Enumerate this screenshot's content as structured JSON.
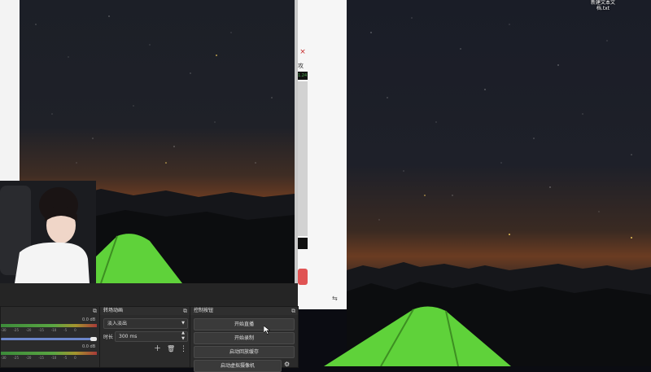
{
  "desktop": {
    "icon_label_line1": "新建文本文",
    "icon_label_line2": "档.txt"
  },
  "middle_window": {
    "close_glyph": "×",
    "label_fragment": "攻程",
    "status_fragment": "1.24"
  },
  "panels": {
    "audio_mixer": {
      "tracks": [
        {
          "db": "0.0 dB",
          "scale": [
            "-30",
            "-25",
            "-20",
            "-15",
            "-10",
            "-5",
            "0"
          ],
          "volume_fraction": 0.95
        },
        {
          "db": "0.0 dB",
          "scale": [
            "-30",
            "-25",
            "-20",
            "-15",
            "-10",
            "-5",
            "0"
          ],
          "volume_fraction": 0.95
        }
      ]
    },
    "transitions": {
      "title": "转场动画",
      "selected_transition": "淡入淡出",
      "duration_label": "时长",
      "duration_value": "300 ms"
    },
    "controls": {
      "title": "控制按钮",
      "buttons": [
        "开始直播",
        "开始录制",
        "启动回放缓存",
        "启动虚拟摄像机"
      ]
    }
  },
  "colors": {
    "obs_panel_bg": "#2b2b2b",
    "tent_green": "#5fd23a",
    "volume_slider": "#6c86c9"
  }
}
